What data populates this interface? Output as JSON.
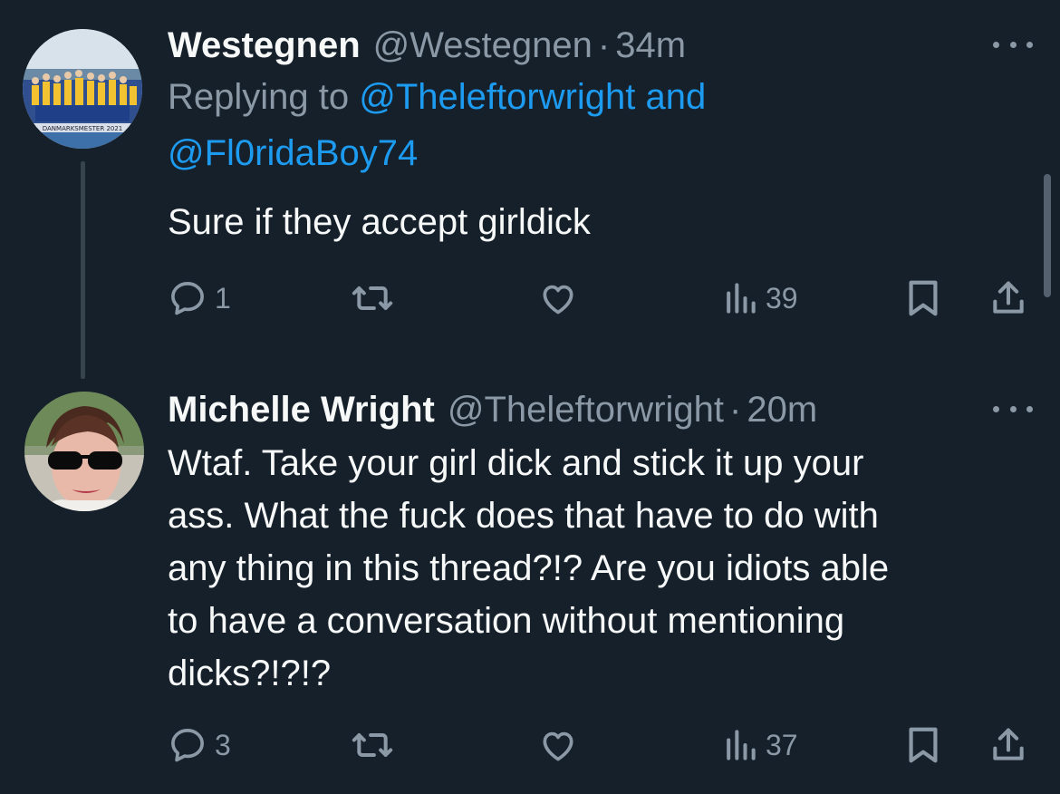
{
  "tweets": [
    {
      "name": "Westegnen",
      "handle": "@Westegnen",
      "dot": "·",
      "time": "34m",
      "replying_prefix": "Replying to ",
      "replying_mention1": "@Theleftorwright and",
      "replying_mention2": "@Fl0ridaBoy74",
      "text": "Sure if they accept girldick",
      "avatar_text": "DANMARKSMESTER 2021",
      "reply_count": "1",
      "views": "39"
    },
    {
      "name": "Michelle Wright",
      "handle": "@Theleftorwright",
      "dot": "·",
      "time": "20m",
      "text_lines": [
        "Wtaf. Take your girl dick and stick it up your",
        "ass. What the fuck does that have to do with",
        "any thing in this thread?!? Are you idiots able",
        "to have a conversation without mentioning",
        "dicks?!?!?"
      ],
      "reply_count": "3",
      "views": "37"
    }
  ],
  "colors": {
    "background": "#15202b",
    "text_primary": "#f7f9f9",
    "text_secondary": "#8b98a5",
    "link": "#1d9bf0",
    "thread_line": "#38444d"
  },
  "icons": [
    "reply-icon",
    "retweet-icon",
    "like-icon",
    "views-icon",
    "bookmark-icon",
    "share-icon",
    "more-icon"
  ]
}
